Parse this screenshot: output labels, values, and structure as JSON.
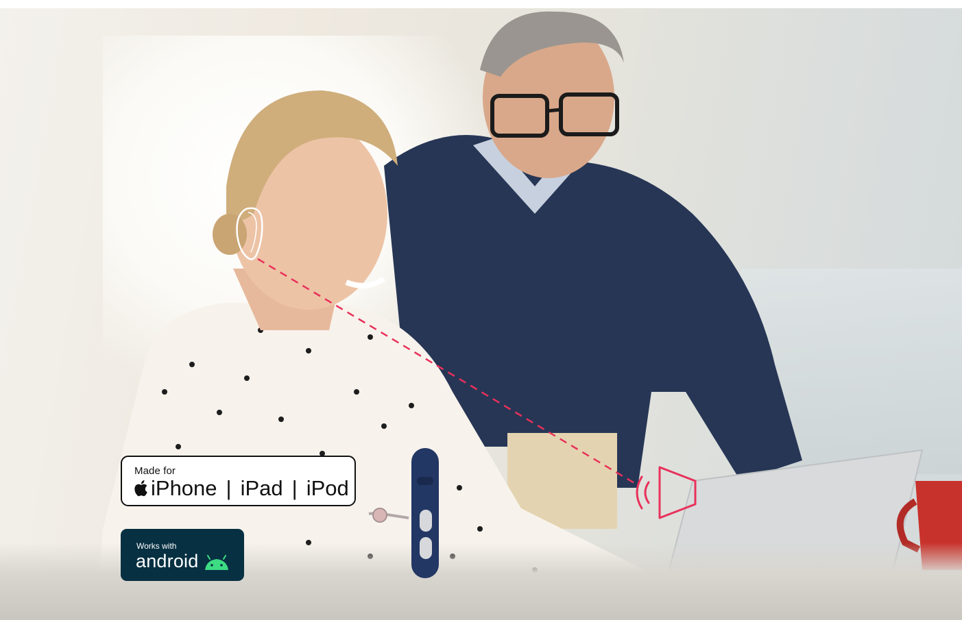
{
  "apple_badge": {
    "made_for": "Made for",
    "iphone": "iPhone",
    "ipad": "iPad",
    "ipod": "iPod",
    "separator": "|"
  },
  "android_badge": {
    "works_with": "Works with",
    "android": "android"
  },
  "icons": [
    "apple-logo-icon",
    "android-robot-icon",
    "speaker-icon",
    "hearing-aid-outline-icon",
    "remote-control-icon"
  ],
  "colors": {
    "accent": "#e8315a",
    "android_badge_bg": "#073042",
    "android_green": "#3ddc84"
  }
}
